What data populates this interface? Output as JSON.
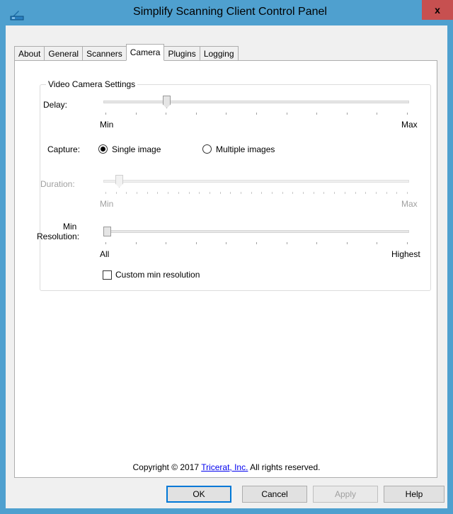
{
  "window": {
    "title": "Simplify Scanning Client Control Panel",
    "close_label": "x"
  },
  "tabs": [
    {
      "label": "About"
    },
    {
      "label": "General"
    },
    {
      "label": "Scanners"
    },
    {
      "label": "Camera",
      "active": true
    },
    {
      "label": "Plugins"
    },
    {
      "label": "Logging"
    }
  ],
  "camera": {
    "group_title": "Video Camera Settings",
    "delay": {
      "label": "Delay:",
      "min_label": "Min",
      "max_label": "Max",
      "ticks": 11,
      "position_fraction": 0.2
    },
    "capture": {
      "label": "Capture:",
      "options": [
        {
          "label": "Single image",
          "selected": true
        },
        {
          "label": "Multiple images",
          "selected": false
        }
      ]
    },
    "duration": {
      "label": "Duration:",
      "min_label": "Min",
      "max_label": "Max",
      "ticks": 30,
      "position_fraction": 0.04,
      "enabled": false
    },
    "min_resolution": {
      "label_line1": "Min",
      "label_line2": "Resolution:",
      "min_label": "All",
      "max_label": "Highest",
      "ticks": 11,
      "position_fraction": 0.0
    },
    "custom_min_resolution": {
      "label": "Custom min resolution",
      "checked": false
    }
  },
  "footer": {
    "copyright_prefix": "Copyright © 2017 ",
    "company_link": "Tricerat, Inc.",
    "copyright_suffix": " All rights reserved."
  },
  "buttons": {
    "ok": "OK",
    "cancel": "Cancel",
    "apply": "Apply",
    "help": "Help"
  },
  "colors": {
    "titlebar": "#4fa0cf",
    "close_button": "#c75050",
    "link": "#0000ee"
  }
}
